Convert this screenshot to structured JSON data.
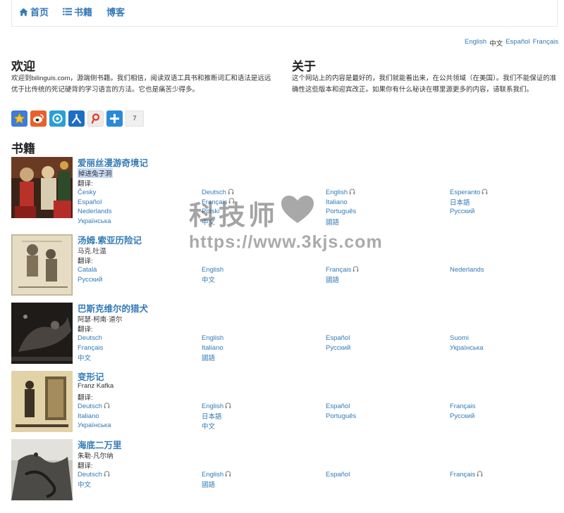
{
  "nav": {
    "home": "首页",
    "books": "书籍",
    "blog": "博客"
  },
  "languages": [
    "English",
    "中文",
    "Español",
    "Français"
  ],
  "welcome": {
    "title": "欢迎",
    "text": "欢迎到bilinguis.com，源端侧书籍。我们相信，阅读双语工具书和推断词汇和语法是远远优于比传统的死记硬背的学习语言的方法。它也是痛苦少得多。"
  },
  "about": {
    "title": "关于",
    "text": "这个网站上的内容是最好的，我们就能看出来，在公共领域（在美国）。我们不能保证的准确性这些版本和迎宾改正。如果你有什么秘诀在哪里源更多的内容，请联系我们。"
  },
  "share": {
    "count": "7"
  },
  "books_heading": "书籍",
  "translations_label": "翻译:",
  "books": [
    {
      "title": "爱丽丝漫游奇境记",
      "author": "掉进兔子洞",
      "translations": [
        {
          "lang": "Česky",
          "audio": false
        },
        {
          "lang": "Deutsch",
          "audio": true
        },
        {
          "lang": "English",
          "audio": true
        },
        {
          "lang": "Esperanto",
          "audio": true
        },
        {
          "lang": "Español",
          "audio": false
        },
        {
          "lang": "Français",
          "audio": true
        },
        {
          "lang": "Italiano",
          "audio": false
        },
        {
          "lang": "日本語",
          "audio": false
        },
        {
          "lang": "Nederlands",
          "audio": false
        },
        {
          "lang": "Polski",
          "audio": false
        },
        {
          "lang": "Português",
          "audio": false
        },
        {
          "lang": "Русский",
          "audio": false
        },
        {
          "lang": "Українська",
          "audio": false
        },
        {
          "lang": "中文",
          "audio": false
        },
        {
          "lang": "國語",
          "audio": false
        }
      ]
    },
    {
      "title": "汤姆.索亚历险记",
      "author": "马克.吐温",
      "translations": [
        {
          "lang": "Català",
          "audio": false
        },
        {
          "lang": "English",
          "audio": false
        },
        {
          "lang": "Français",
          "audio": true
        },
        {
          "lang": "Nederlands",
          "audio": false
        },
        {
          "lang": "Русский",
          "audio": false
        },
        {
          "lang": "中文",
          "audio": false
        },
        {
          "lang": "國語",
          "audio": false
        }
      ]
    },
    {
      "title": "巴斯克维尔的猎犬",
      "author": "阿瑟·柯南·道尔",
      "translations": [
        {
          "lang": "Deutsch",
          "audio": false
        },
        {
          "lang": "English",
          "audio": false
        },
        {
          "lang": "Español",
          "audio": false
        },
        {
          "lang": "Suomi",
          "audio": false
        },
        {
          "lang": "Français",
          "audio": false
        },
        {
          "lang": "Italiano",
          "audio": false
        },
        {
          "lang": "Русский",
          "audio": false
        },
        {
          "lang": "Українська",
          "audio": false
        },
        {
          "lang": "中文",
          "audio": false
        },
        {
          "lang": "國語",
          "audio": false
        }
      ]
    },
    {
      "title": "变形记",
      "author": "Franz Kafka",
      "translations": [
        {
          "lang": "Deutsch",
          "audio": true
        },
        {
          "lang": "English",
          "audio": true
        },
        {
          "lang": "Español",
          "audio": false
        },
        {
          "lang": "Français",
          "audio": false
        },
        {
          "lang": "Italiano",
          "audio": false
        },
        {
          "lang": "日本語",
          "audio": false
        },
        {
          "lang": "Português",
          "audio": false
        },
        {
          "lang": "Русский",
          "audio": false
        },
        {
          "lang": "Українська",
          "audio": false
        },
        {
          "lang": "中文",
          "audio": false
        }
      ]
    },
    {
      "title": "海底二万里",
      "author": "朱勒·凡尔纳",
      "translations": [
        {
          "lang": "Deutsch",
          "audio": true
        },
        {
          "lang": "English",
          "audio": true
        },
        {
          "lang": "Español",
          "audio": false
        },
        {
          "lang": "Français",
          "audio": true
        },
        {
          "lang": "中文",
          "audio": false
        },
        {
          "lang": "國語",
          "audio": false
        }
      ]
    }
  ],
  "watermark": {
    "title": "科技师",
    "url": "https://www.3kjs.com"
  },
  "icons": {
    "home": "home-icon",
    "books": "list-icon",
    "audio": "headphones-icon",
    "watermark": "heart-icon"
  },
  "colors": {
    "link": "#337ab7",
    "highlight": "#c9daf4"
  }
}
